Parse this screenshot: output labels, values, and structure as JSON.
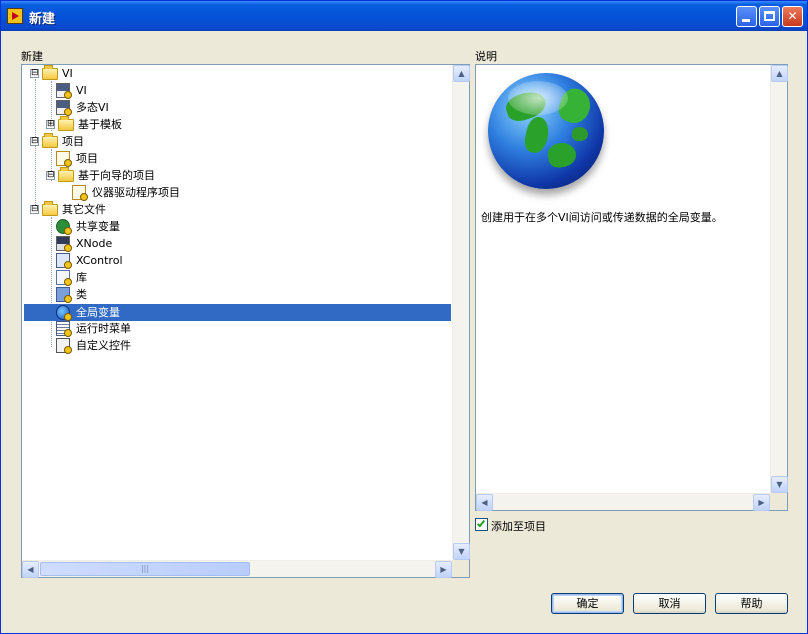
{
  "window": {
    "title": "新建",
    "icons": [
      "app-icon",
      "minimize-icon",
      "maximize-icon",
      "close-icon"
    ]
  },
  "left_panel": {
    "label": "新建",
    "tree": [
      {
        "label": "VI",
        "icon": "folder-icon",
        "expander": "⊟"
      },
      {
        "label": "VI",
        "icon": "vi-icon"
      },
      {
        "label": "多态VI",
        "icon": "polymorphic-vi-icon"
      },
      {
        "label": "基于模板",
        "icon": "folder-icon",
        "expander": "⊞"
      },
      {
        "label": "项目",
        "icon": "folder-icon",
        "expander": "⊟"
      },
      {
        "label": "项目",
        "icon": "project-icon"
      },
      {
        "label": "基于向导的项目",
        "icon": "folder-icon",
        "expander": "⊟"
      },
      {
        "label": "仪器驱动程序项目",
        "icon": "project-icon"
      },
      {
        "label": "其它文件",
        "icon": "folder-icon",
        "expander": "⊟"
      },
      {
        "label": "共享变量",
        "icon": "shared-variable-icon"
      },
      {
        "label": "XNode",
        "icon": "xnode-icon"
      },
      {
        "label": "XControl",
        "icon": "xcontrol-icon"
      },
      {
        "label": "库",
        "icon": "library-icon"
      },
      {
        "label": "类",
        "icon": "class-icon"
      },
      {
        "label": "全局变量",
        "icon": "global-variable-icon",
        "selected": true
      },
      {
        "label": "运行时菜单",
        "icon": "runtime-menu-icon"
      },
      {
        "label": "自定义控件",
        "icon": "custom-control-icon"
      }
    ]
  },
  "right_panel": {
    "label": "说明",
    "image_icon": "globe-icon",
    "description": "创建用于在多个VI间访问或传递数据的全局变量。"
  },
  "add_to_project": {
    "label": "添加至项目",
    "checked": true
  },
  "buttons": {
    "ok": "确定",
    "cancel": "取消",
    "help": "帮助"
  },
  "scrollbars": {
    "up_arrow": "▲",
    "down_arrow": "▼",
    "left_arrow": "◀",
    "right_arrow": "▶",
    "grip": "|||"
  },
  "colors": {
    "selection": "#316ac5",
    "titlebar": "#0453d8",
    "dialog_bg": "#ece9d8"
  }
}
